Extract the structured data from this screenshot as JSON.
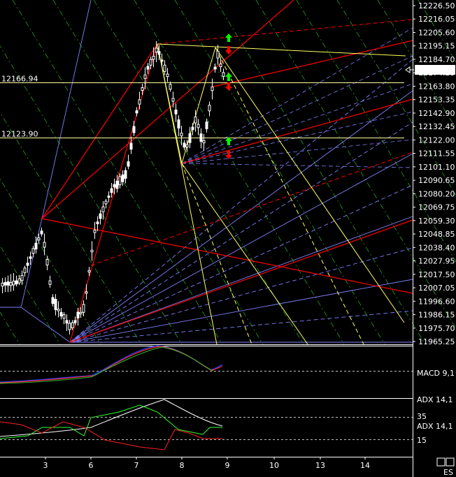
{
  "chart_data": [
    {
      "type": "candlestick",
      "symbol": "ES",
      "y_ticks": [
        12226.5,
        12216.05,
        12205.6,
        12195.15,
        12184.7,
        12174.25,
        12163.8,
        12153.35,
        12142.9,
        12132.45,
        12122.0,
        12111.55,
        12101.1,
        12090.65,
        12080.2,
        12069.75,
        12059.3,
        12048.85,
        12038.4,
        12027.95,
        12017.5,
        12007.05,
        11996.6,
        11986.15,
        11975.7,
        11965.25
      ],
      "ylim": [
        11965.25,
        12226.5
      ],
      "x_ticks": [
        "3",
        "6",
        "7",
        "8",
        "9",
        "10",
        "13",
        "14"
      ],
      "last_price": "12176.54",
      "horizontal_levels": [
        {
          "label": "12166.94",
          "value": 12166.94
        },
        {
          "label": "12123.90",
          "value": 12123.9
        }
      ],
      "candles_approx": [
        {
          "x": "3",
          "o": 12002,
          "h": 12010,
          "l": 11990,
          "c": 12005
        },
        {
          "x": "3",
          "o": 12005,
          "h": 12060,
          "l": 11995,
          "c": 12020
        },
        {
          "x": "6",
          "o": 11980,
          "h": 11990,
          "l": 11965,
          "c": 11985
        },
        {
          "x": "6",
          "o": 11985,
          "h": 12040,
          "l": 11980,
          "c": 12035
        },
        {
          "x": "7",
          "o": 12090,
          "h": 12140,
          "l": 12085,
          "c": 12135
        },
        {
          "x": "7",
          "o": 12135,
          "h": 12195,
          "l": 12130,
          "c": 12180
        },
        {
          "x": "8",
          "o": 12180,
          "h": 12190,
          "l": 12130,
          "c": 12140
        },
        {
          "x": "8",
          "o": 12140,
          "h": 12160,
          "l": 12105,
          "c": 12125
        },
        {
          "x": "9",
          "o": 12125,
          "h": 12193,
          "l": 12115,
          "c": 12185
        },
        {
          "x": "9",
          "o": 12185,
          "h": 12190,
          "l": 12170,
          "c": 12176
        }
      ]
    },
    {
      "type": "line",
      "indicator": "MACD 9,1",
      "title": "MACD 9,1"
    },
    {
      "type": "line",
      "indicator": "ADX 14,1",
      "title": "ADX 14,1",
      "labels": [
        "ADX 14,1",
        "35",
        "ADX 14,1",
        "15"
      ],
      "levels": [
        35,
        15
      ]
    }
  ],
  "colors": {
    "background": "#000000",
    "price_axis_text": "#ffffff",
    "last_price_box_bg": "#ffffff",
    "last_price_box_text": "#000000",
    "level_line": "#ffffa0",
    "red_fan": "#ff0000",
    "yellow_fan": "#ffff60",
    "blue_fan": "#8080ff",
    "green_fan": "#20a020",
    "macd_line_blue": "#2040ff",
    "macd_line_red": "#ff3030",
    "macd_line_green": "#30c030",
    "adx_white": "#ffffff",
    "adx_green": "#30ff30",
    "adx_red": "#ff2020",
    "arrow_up": "#00ff00",
    "arrow_down": "#ff0000"
  },
  "footer": {
    "symbol_label": "ES",
    "buttons": [
      "btn1",
      "btn2"
    ]
  }
}
